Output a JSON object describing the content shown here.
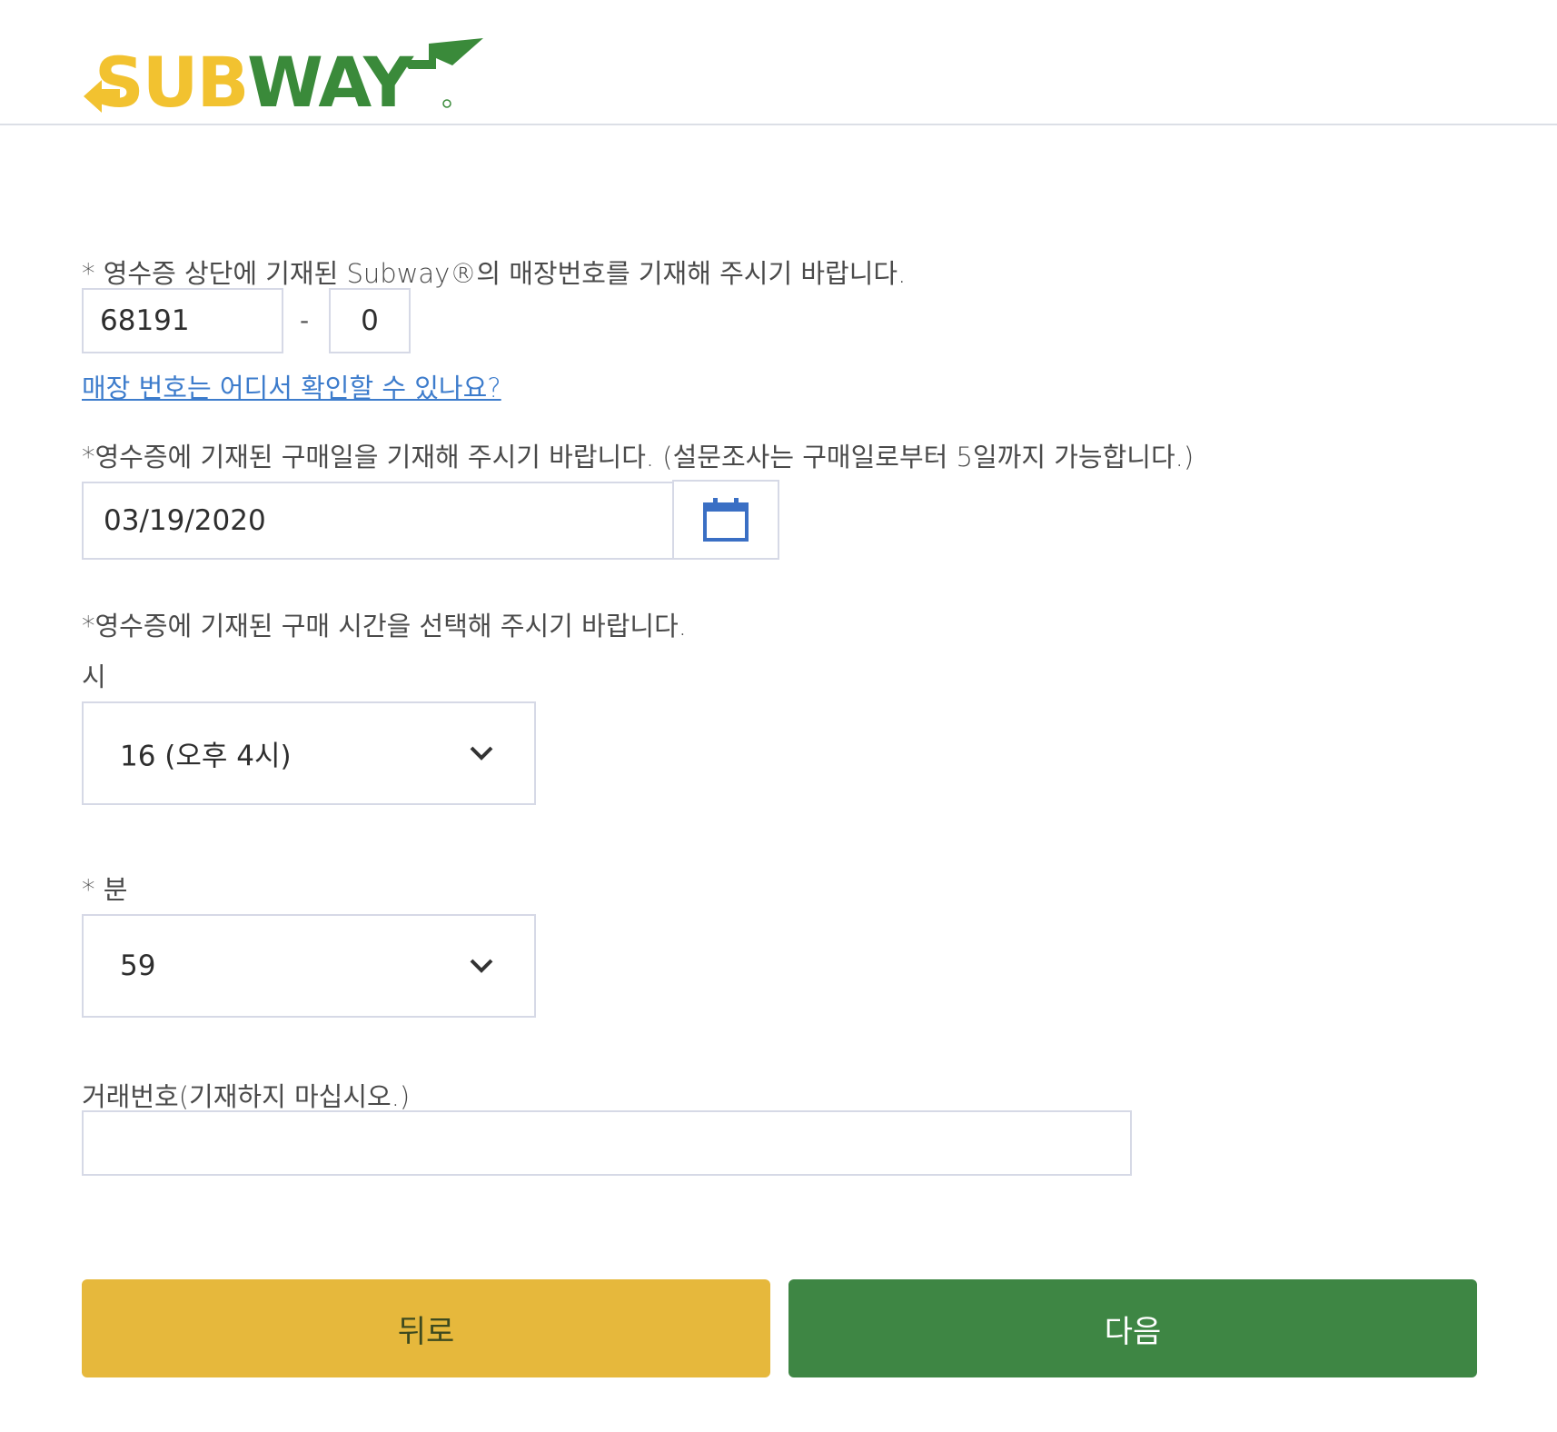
{
  "brand": {
    "name": "SUBWAY",
    "yellow": "#f2c230",
    "green": "#3a8a3a"
  },
  "store": {
    "label": "* 영수증 상단에 기재된 Subway®의 매장번호를 기재해 주시기 바랍니다.",
    "number_value": "68191",
    "separator": "-",
    "suffix_value": "0",
    "help_link": "매장 번호는 어디서 확인할 수 있나요?"
  },
  "date": {
    "label": "*영수증에 기재된 구매일을 기재해 주시기 바랍니다. (설문조사는 구매일로부터 5일까지 가능합니다.)",
    "value": "03/19/2020",
    "icon": "calendar-icon",
    "icon_color": "#3a6fc4"
  },
  "time": {
    "label": "*영수증에 기재된 구매 시간을 선택해 주시기 바랍니다.",
    "hour_label": "시",
    "hour_value": "16 (오후 4시)",
    "minute_label": "* 분",
    "minute_value": "59"
  },
  "transaction": {
    "label": "거래번호(기재하지 마십시오.)",
    "value": ""
  },
  "buttons": {
    "back": "뒤로",
    "next": "다음",
    "back_color": "#e6b83c",
    "next_color": "#3e8644"
  }
}
